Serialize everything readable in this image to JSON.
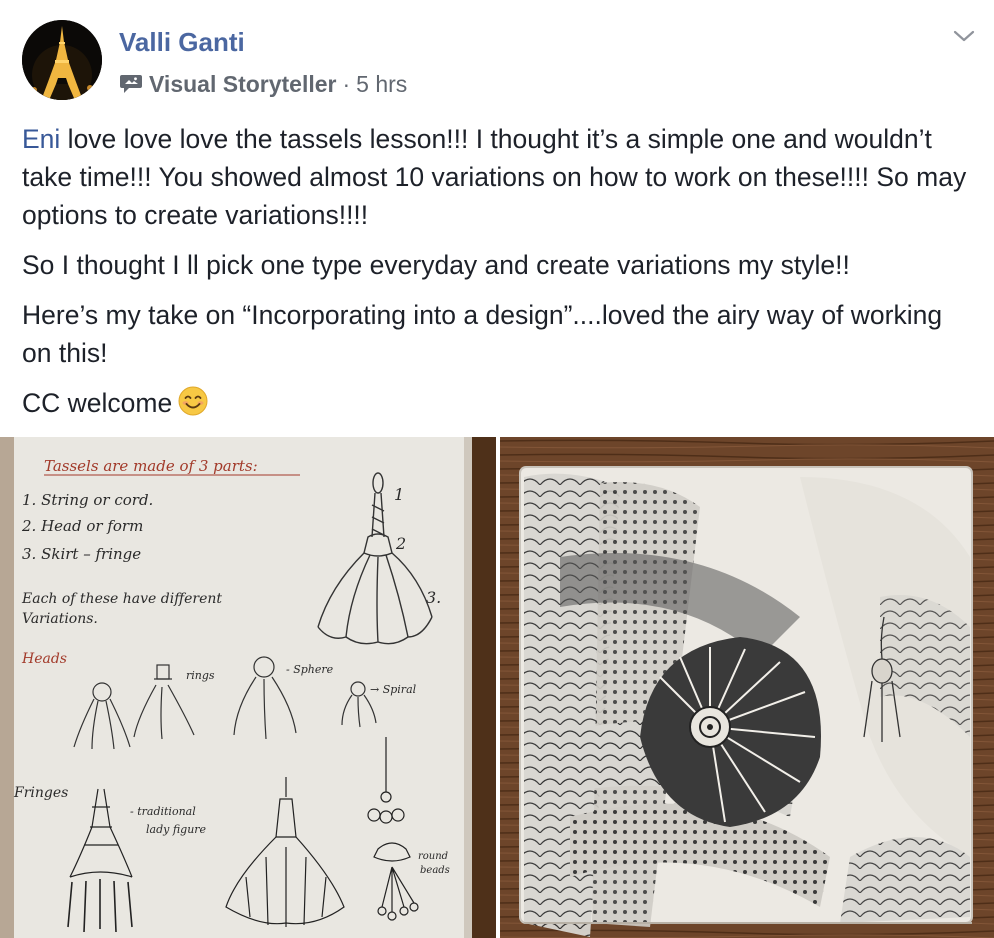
{
  "post": {
    "author": "Valli Ganti",
    "group": "Visual Storyteller",
    "separator": "·",
    "time": "5 hrs",
    "paragraphs": {
      "p1_mention": "Eni",
      "p1_text": " love love love the tassels lesson!!! I thought it’s a simple one and wouldn’t take time!!! You showed almost 10 variations on how to work on these!!!! So may options to create variations!!!!",
      "p2": "So I thought I ll pick one type everyday and create variations my style!!",
      "p3": "Here’s my take on “Incorporating into a design”....loved the airy way of working on this!",
      "p4": "CC welcome"
    }
  },
  "photo_left": {
    "heading": "Tassels are made of 3 parts:",
    "list": [
      "1. String or cord.",
      "2. Head or form",
      "3. Skirt – fringe"
    ],
    "part_numbers": [
      "1",
      "2",
      "3."
    ],
    "note_line1": "Each of these have different",
    "note_line2": "Variations.",
    "heads_label": "Heads",
    "rings_label": "rings",
    "sphere_label": "- Sphere",
    "spiral_label": "→ Spiral",
    "fringes_label": "Fringes",
    "traditional_line1": "- traditional",
    "traditional_line2": "lady figure",
    "round_line1": "round",
    "round_line2": "beads"
  },
  "icons": {
    "group_icon": "speech-bubble-icon",
    "menu_icon": "chevron-down-icon",
    "emoji": "smiling-face-icon"
  },
  "colors": {
    "author": "#4b67a1",
    "mention": "#385898",
    "text": "#1d2129",
    "meta": "#616770"
  }
}
